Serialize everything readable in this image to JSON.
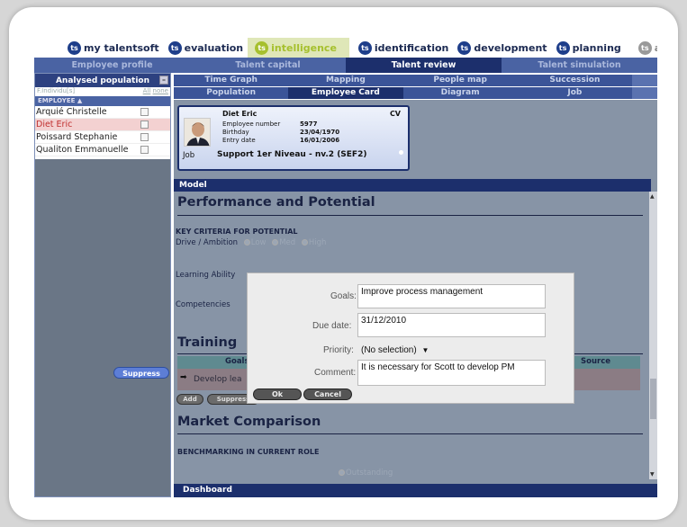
{
  "top_nav": [
    {
      "label": "my talentsoft",
      "style": "normal"
    },
    {
      "label": "evaluation",
      "style": "normal"
    },
    {
      "label": "intelligence",
      "style": "highlight"
    },
    {
      "label": "identification",
      "style": "normal"
    },
    {
      "label": "development",
      "style": "normal"
    },
    {
      "label": "planning",
      "style": "normal"
    },
    {
      "label": "admin",
      "style": "gray"
    }
  ],
  "secondary_nav": [
    {
      "label": "Employee profile"
    },
    {
      "label": "Talent capital"
    },
    {
      "label": "Talent review",
      "active": true
    },
    {
      "label": "Talent simulation"
    }
  ],
  "left_panel": {
    "title": "Analysed population",
    "filter_label": "F.Individu[s]",
    "filter_all": "All",
    "filter_none": "none",
    "employee_header": "EMPLOYEE ▲",
    "employees": [
      {
        "name": "Arquié Christelle",
        "selected": false
      },
      {
        "name": "Diet Eric",
        "selected": true
      },
      {
        "name": "Poissard Stephanie",
        "selected": false
      },
      {
        "name": "Qualiton Emmanuelle",
        "selected": false
      }
    ],
    "suppress_label": "Suppress"
  },
  "sub_nav": {
    "row1": [
      "Time Graph",
      "Mapping",
      "People map",
      "Succession"
    ],
    "row2": [
      {
        "label": "Population",
        "active": false
      },
      {
        "label": "Employee Card",
        "active": true
      },
      {
        "label": "Diagram",
        "active": false
      },
      {
        "label": "Job",
        "active": false
      }
    ]
  },
  "employee_card": {
    "name": "Diet Eric",
    "cv": "CV",
    "fields": [
      {
        "label": "Employee number",
        "value": "5977"
      },
      {
        "label": "Birthday",
        "value": "23/04/1970"
      },
      {
        "label": "Entry date",
        "value": "16/01/2006"
      }
    ],
    "job_label": "Job",
    "job_value": "Support 1er Niveau - nv.2 (SEF2)"
  },
  "model_bar": "Model",
  "performance": {
    "title": "Performance and Potential",
    "key_criteria": "KEY CRITERIA FOR POTENTIAL",
    "drive_label": "Drive / Ambition",
    "radio_low": "Low",
    "radio_med": "Med",
    "radio_high": "High",
    "learning_label": "Learning Ability",
    "competencies_label": "Competencies"
  },
  "training": {
    "title": "Training",
    "col_goals": "Goals",
    "col_source": "Source",
    "row_text": "Develop lea",
    "add_label": "Add",
    "suppress_label": "Suppress"
  },
  "market": {
    "title": "Market Comparison",
    "benchmark": "BENCHMARKING IN CURRENT ROLE",
    "outstanding": "Outstanding"
  },
  "dashboard_bar": "Dashboard",
  "dialog": {
    "goals_label": "Goals:",
    "goals_value": "Improve process management",
    "due_label": "Due date:",
    "due_value": "31/12/2010",
    "priority_label": "Priority:",
    "priority_value": "(No selection)",
    "comment_label": "Comment:",
    "comment_value": "It is necessary for Scott to develop PM",
    "ok_label": "Ok",
    "cancel_label": "Cancel"
  }
}
